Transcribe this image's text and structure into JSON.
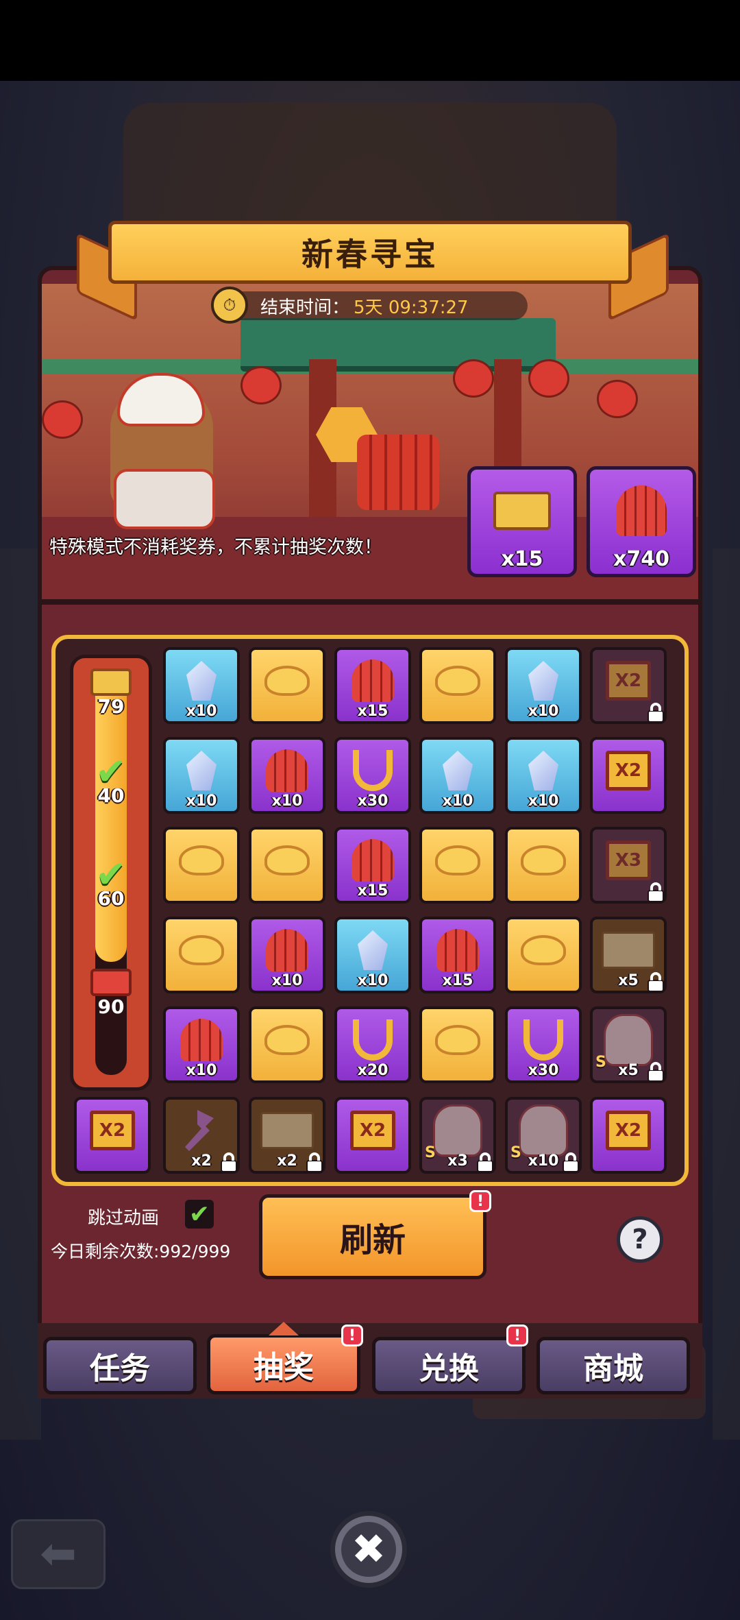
{
  "title": "新春寻宝",
  "timer": {
    "label": "结束时间：",
    "value": "5天 09:37:27"
  },
  "notice": "特殊模式不消耗奖券，不累计抽奖次数！",
  "currencies": [
    {
      "icon": "ticket-icon",
      "count": "x15"
    },
    {
      "icon": "firecracker-icon",
      "count": "x740"
    }
  ],
  "progress": {
    "milestones": [
      {
        "value": "79",
        "state": "current",
        "icon": "ticket-icon"
      },
      {
        "value": "40",
        "state": "claimed",
        "icon": "check-icon"
      },
      {
        "value": "60",
        "state": "claimed",
        "icon": "check-icon"
      },
      {
        "value": "90",
        "state": "pending",
        "icon": "gift-icon"
      }
    ],
    "fill_fraction": 0.72
  },
  "grid": [
    [
      {
        "color": "blue",
        "item": "crystal",
        "count": "x10"
      },
      {
        "color": "gold",
        "item": "ingot",
        "count": ""
      },
      {
        "color": "purple",
        "item": "firecracker",
        "count": "x15"
      },
      {
        "color": "gold",
        "item": "ingot",
        "count": ""
      },
      {
        "color": "blue",
        "item": "crystal",
        "count": "x10"
      },
      {
        "color": "dim",
        "item": "x2",
        "label": "X2",
        "count": "",
        "locked": true
      }
    ],
    [
      {
        "color": "blue",
        "item": "crystal",
        "count": "x10"
      },
      {
        "color": "purple",
        "item": "firecracker",
        "count": "x10"
      },
      {
        "color": "purple",
        "item": "horseshoe",
        "count": "x30"
      },
      {
        "color": "blue",
        "item": "crystal",
        "count": "x10"
      },
      {
        "color": "blue",
        "item": "crystal",
        "count": "x10"
      },
      {
        "color": "purple",
        "item": "x2",
        "label": "X2",
        "count": ""
      }
    ],
    [
      {
        "color": "gold",
        "item": "ingot",
        "count": ""
      },
      {
        "color": "gold",
        "item": "ingot",
        "count": ""
      },
      {
        "color": "purple",
        "item": "firecracker",
        "count": "x15"
      },
      {
        "color": "gold",
        "item": "ingot",
        "count": ""
      },
      {
        "color": "gold",
        "item": "ingot",
        "count": ""
      },
      {
        "color": "dim",
        "item": "x3",
        "label": "X3",
        "count": "",
        "locked": true
      }
    ],
    [
      {
        "color": "gold",
        "item": "ingot",
        "count": ""
      },
      {
        "color": "purple",
        "item": "firecracker",
        "count": "x10"
      },
      {
        "color": "blue",
        "item": "crystal",
        "count": "x10"
      },
      {
        "color": "purple",
        "item": "firecracker",
        "count": "x15"
      },
      {
        "color": "gold",
        "item": "ingot",
        "count": ""
      },
      {
        "color": "dimbrown",
        "item": "envelope",
        "count": "x5",
        "locked": true
      }
    ],
    [
      {
        "color": "purple",
        "item": "firecracker",
        "count": "x10"
      },
      {
        "color": "gold",
        "item": "ingot",
        "count": ""
      },
      {
        "color": "purple",
        "item": "horseshoe",
        "count": "x20"
      },
      {
        "color": "gold",
        "item": "ingot",
        "count": ""
      },
      {
        "color": "purple",
        "item": "horseshoe",
        "count": "x30"
      },
      {
        "color": "dim",
        "item": "girl",
        "count": "x5",
        "locked": true,
        "badge": "S"
      }
    ]
  ],
  "bottom_row": [
    {
      "color": "purple",
      "item": "x2",
      "label": "X2",
      "count": ""
    },
    {
      "color": "dimbrown",
      "item": "key",
      "count": "x2",
      "locked": true
    },
    {
      "color": "dimbrown",
      "item": "envelope",
      "count": "x2",
      "locked": true
    },
    {
      "color": "purple",
      "item": "x2",
      "label": "X2",
      "count": ""
    },
    {
      "color": "dim",
      "item": "girl",
      "count": "x3",
      "locked": true,
      "badge": "S"
    },
    {
      "color": "dim",
      "item": "girl",
      "count": "x10",
      "locked": true,
      "badge": "S"
    },
    {
      "color": "purple",
      "item": "x2",
      "label": "X2",
      "count": ""
    }
  ],
  "controls": {
    "skip_label": "跳过动画",
    "skip_checked": "✔",
    "remaining": "今日剩余次数:992/999",
    "refresh_label": "刷新",
    "help_label": "?",
    "badge": "!"
  },
  "tabs": [
    {
      "label": "任务",
      "active": false,
      "badge": false
    },
    {
      "label": "抽奖",
      "active": true,
      "badge": true
    },
    {
      "label": "兑换",
      "active": false,
      "badge": true
    },
    {
      "label": "商城",
      "active": false,
      "badge": false
    }
  ],
  "close_label": "✖",
  "back_label": "⬅",
  "colors": {
    "panel": "#6b2630",
    "board_border": "#f2b83a",
    "tab_active": "#e2643e",
    "tab": "#4a3e64",
    "badge": "#e8344a",
    "timer_value": "#ffc845"
  }
}
